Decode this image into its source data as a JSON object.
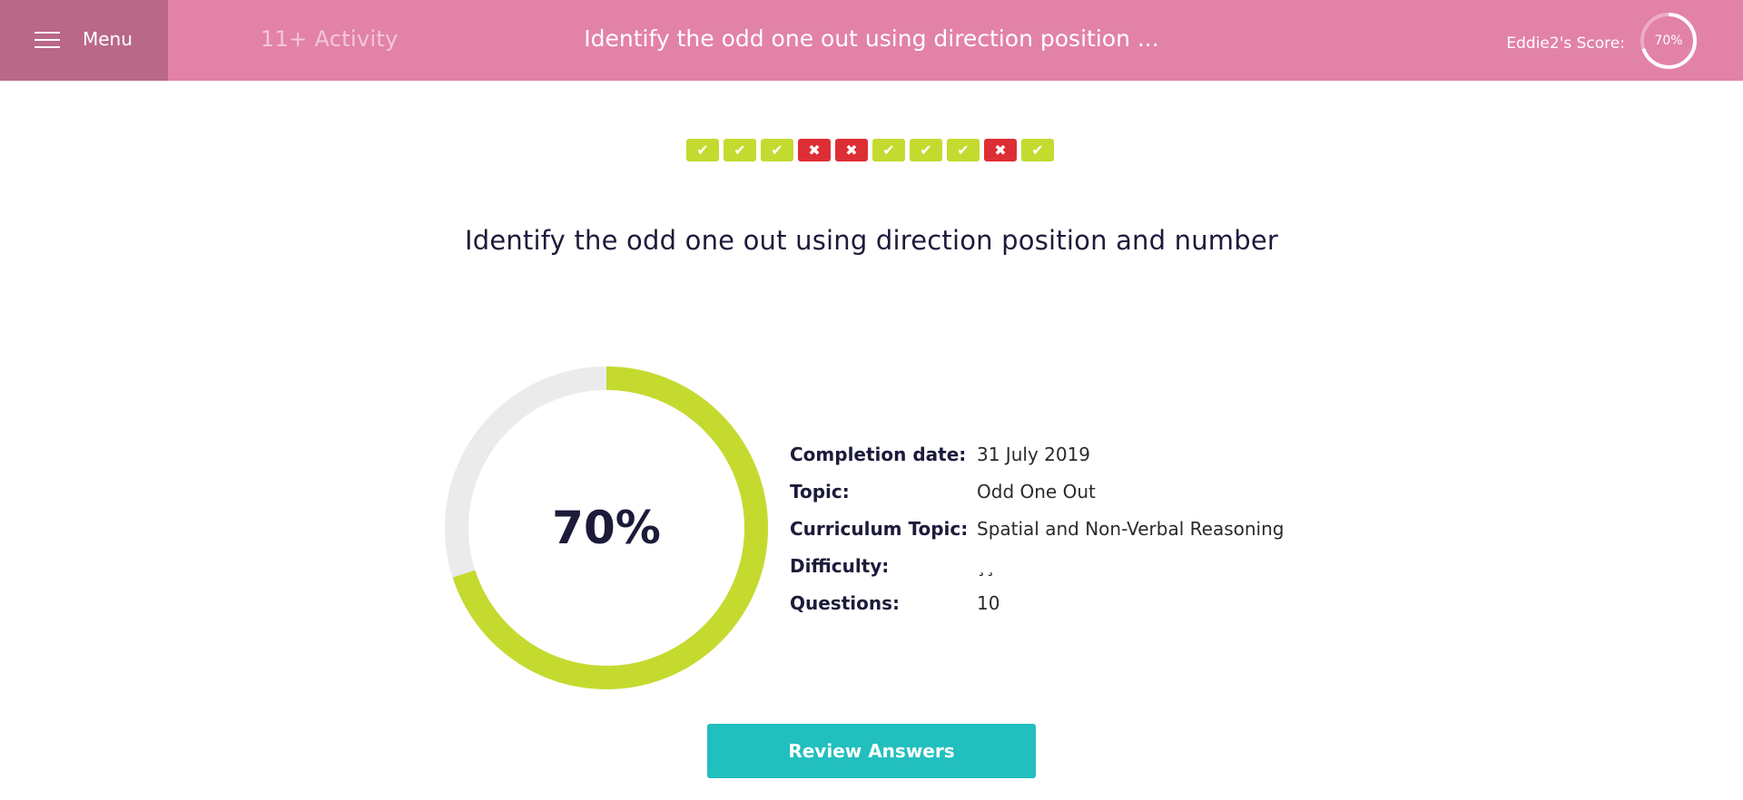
{
  "colors": {
    "header_bg": "#e282a6",
    "menu_bg": "#b96887",
    "correct": "#c5da2f",
    "incorrect": "#dd2e35",
    "ring_track": "#ebebeb",
    "button": "#22bfbf"
  },
  "header": {
    "menu_label": "Menu",
    "activity_label": "11+ Activity",
    "title": "Identify the odd one out using direction position ...",
    "score_label": "Eddie2's Score:",
    "score_text": "70%",
    "score_fraction": 0.7
  },
  "results": [
    "correct",
    "correct",
    "correct",
    "incorrect",
    "incorrect",
    "correct",
    "correct",
    "correct",
    "incorrect",
    "correct"
  ],
  "main": {
    "title": "Identify the odd one out using direction position and number",
    "score_text": "70%",
    "score_fraction": 0.7
  },
  "details": [
    {
      "label": "Completion date:",
      "value": "31 July 2019"
    },
    {
      "label": "Topic:",
      "value": "Odd One Out"
    },
    {
      "label": "Curriculum Topic:",
      "value": "Spatial and Non-Verbal Reasoning"
    },
    {
      "label": "Difficulty:",
      "value": "¸¸"
    },
    {
      "label": "Questions:",
      "value": "10"
    }
  ],
  "review_button": {
    "label": "Review Answers"
  }
}
